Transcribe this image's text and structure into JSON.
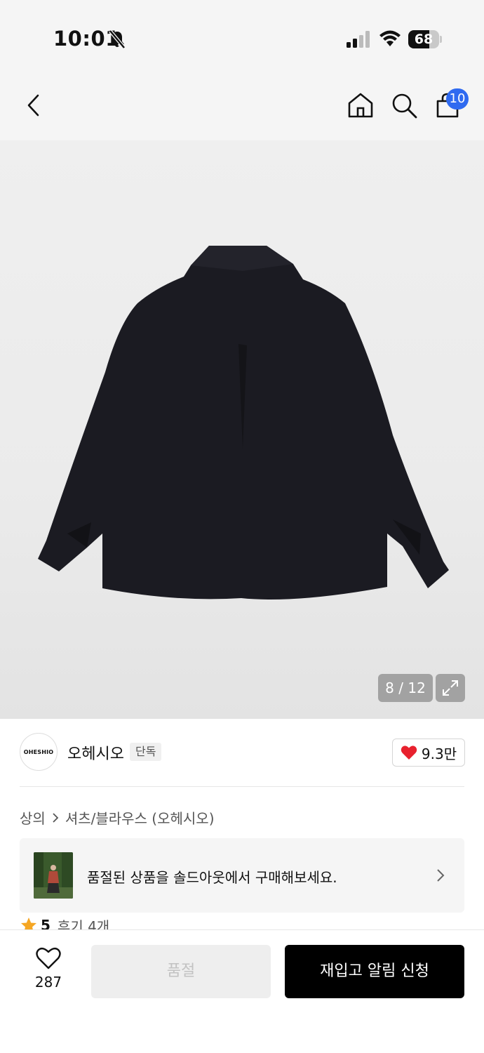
{
  "status_bar": {
    "time": "10:01",
    "battery": "68",
    "battery_level": 0.68
  },
  "header": {
    "cart_count": "10"
  },
  "gallery": {
    "counter": "8 / 12"
  },
  "brand": {
    "logo_text": "OHESHIO",
    "name": "오헤시오",
    "badge": "단독",
    "like_count": "9.3만"
  },
  "breadcrumb": {
    "category": "상의",
    "subcategory": "셔츠/블라우스 (오헤시오)"
  },
  "soldout_banner": {
    "text": "품절된 상품을 솔드아웃에서 구매해보세요."
  },
  "rating": {
    "score": "5",
    "reviews": "후기 4개"
  },
  "bottom_bar": {
    "wishlist_count": "287",
    "soldout_label": "품절",
    "restock_label": "재입고 알림 신청"
  },
  "colors": {
    "accent_blue": "#2f6af0",
    "heart_red": "#e8212e",
    "star_orange": "#f5a623",
    "primary_black": "#000000"
  },
  "icons": [
    "bell-slash-icon",
    "signal-icon",
    "wifi-icon",
    "battery-icon",
    "back-chevron-icon",
    "home-icon",
    "search-icon",
    "shopping-bag-icon",
    "expand-icon",
    "heart-filled-icon",
    "chevron-right-icon",
    "star-icon",
    "heart-outline-icon"
  ]
}
